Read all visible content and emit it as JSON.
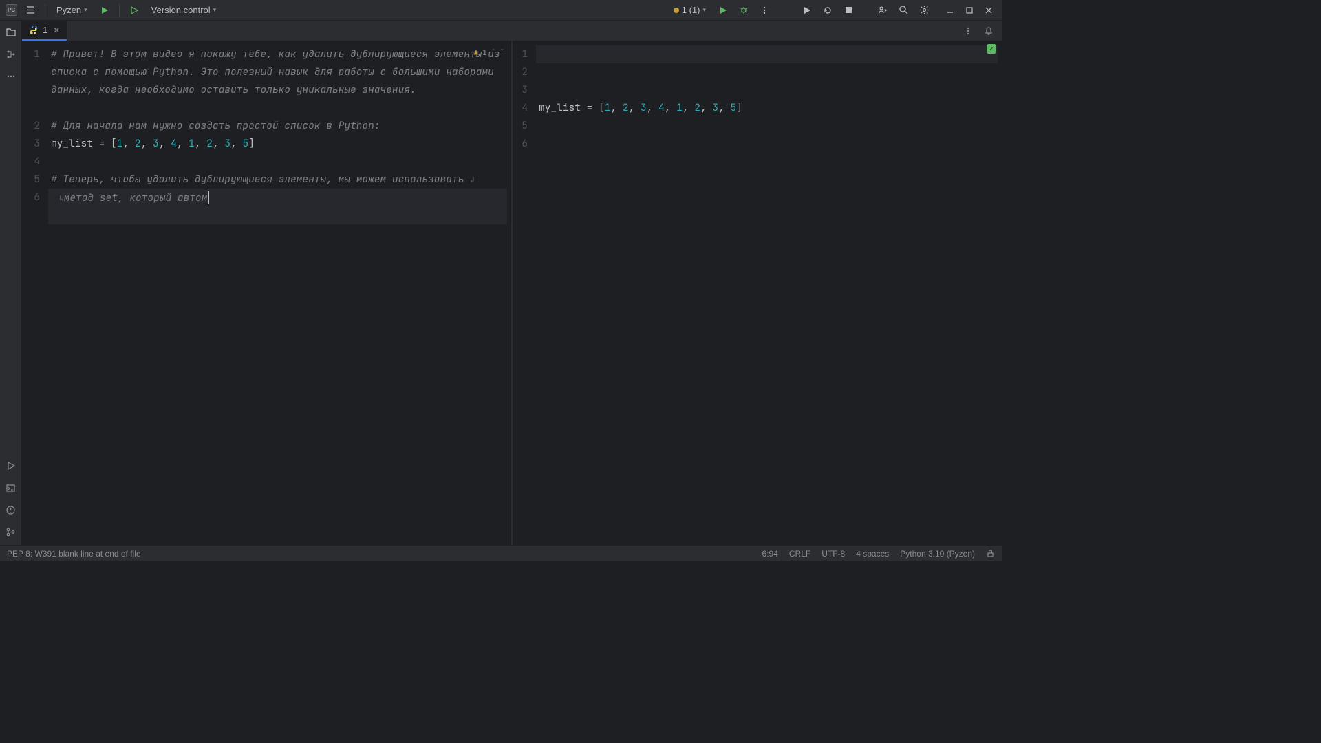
{
  "titlebar": {
    "run_config": "Pyzen",
    "version_control": "Version control",
    "run_stats": "1 (1)"
  },
  "tab": {
    "name": "1"
  },
  "left_editor": {
    "inspection_count": "1",
    "lines": {
      "1": "# Привет! В этом видео я покажу тебе, как удалить дублирующиеся элементы из списка с помощью Python. Это полезный навык для работы с большими наборами данных, когда необходимо оставить только уникальные значения.",
      "3": "# Для начала нам нужно создать простой список в Python:",
      "4_ident": "my_list",
      "4_eq": " = [",
      "4_nums": [
        "1",
        "2",
        "3",
        "4",
        "1",
        "2",
        "3",
        "5"
      ],
      "6a": "# Теперь, чтобы удалить дублирующиеся элементы, мы можем использовать ",
      "6b": "метод set, который автом"
    },
    "gutter": [
      "1",
      "2",
      "3",
      "4",
      "5",
      "6"
    ]
  },
  "right_editor": {
    "gutter": [
      "1",
      "2",
      "3",
      "4",
      "5",
      "6"
    ],
    "line4_ident": "my_list",
    "line4_eq": " = [",
    "line4_nums": [
      "1",
      "2",
      "3",
      "4",
      "1",
      "2",
      "3",
      "5"
    ]
  },
  "statusbar": {
    "hint": "PEP 8: W391 blank line at end of file",
    "pos": "6:94",
    "le": "CRLF",
    "enc": "UTF-8",
    "indent": "4 spaces",
    "interp": "Python 3.10 (Pyzen)"
  }
}
